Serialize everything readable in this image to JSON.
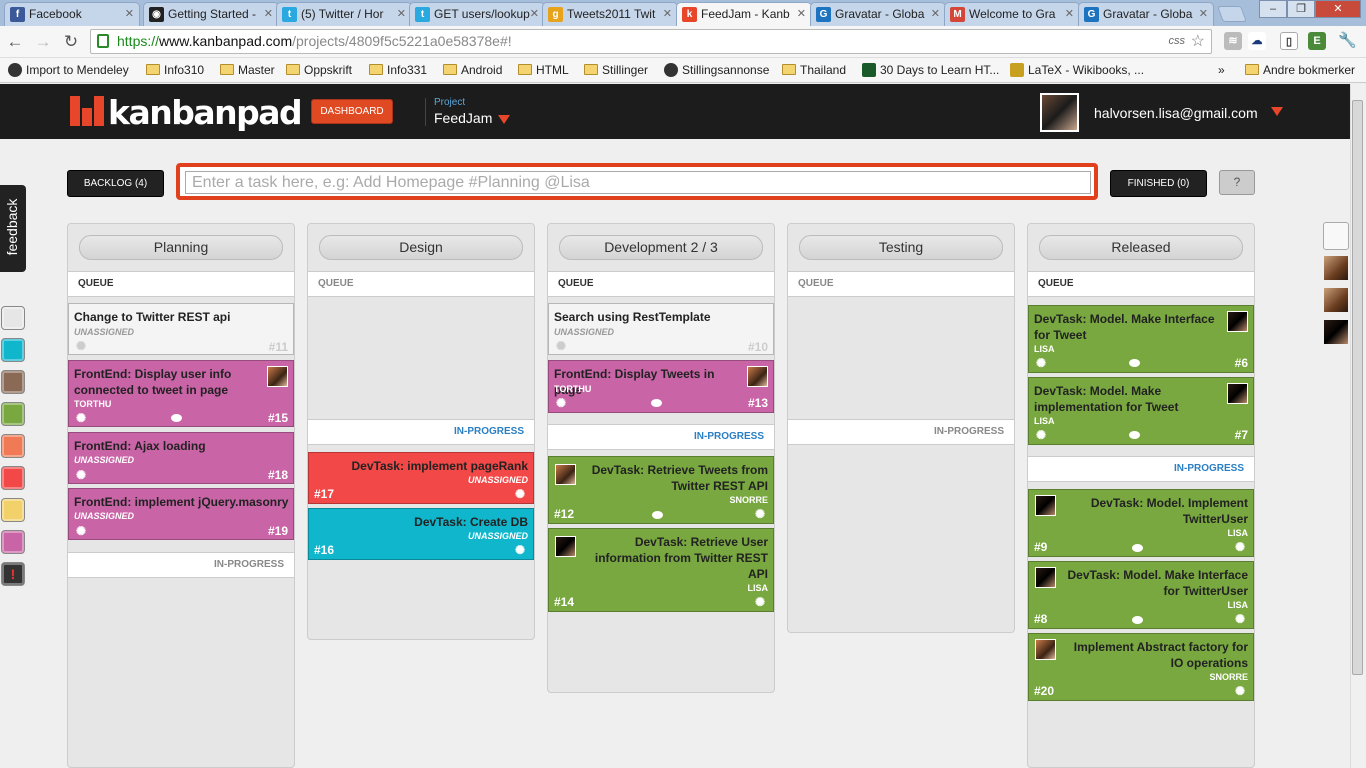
{
  "browser": {
    "tabs": [
      {
        "label": "Facebook",
        "icon": "facebook-icon",
        "color": "#3b5998",
        "glyph": "f"
      },
      {
        "label": "Getting Started -",
        "icon": "github-icon",
        "color": "#222222",
        "glyph": "◉"
      },
      {
        "label": "(5) Twitter / Hor",
        "icon": "twitter-icon",
        "color": "#2aa9e0",
        "glyph": "t"
      },
      {
        "label": "GET users/lookup",
        "icon": "twitter-icon",
        "color": "#2aa9e0",
        "glyph": "t"
      },
      {
        "label": "Tweets2011 Twit",
        "icon": "google-icon",
        "color": "#e8a31d",
        "glyph": "g"
      },
      {
        "label": "FeedJam - Kanb",
        "icon": "kanbanpad-icon",
        "color": "#e8462a",
        "glyph": "k"
      },
      {
        "label": "Gravatar - Globa",
        "icon": "gravatar-icon",
        "color": "#1e73be",
        "glyph": "G"
      },
      {
        "label": "Welcome to Gra",
        "icon": "gmail-icon",
        "color": "#d44638",
        "glyph": "M"
      },
      {
        "label": "Gravatar - Globa",
        "icon": "gravatar-icon",
        "color": "#1e73be",
        "glyph": "G"
      }
    ],
    "url_scheme": "https://",
    "url_host": "www.kanbanpad.com",
    "url_path": "/projects/4809f5c5221a0e58378e#!",
    "css_label": "css",
    "bookmarks": [
      {
        "label": "Import to Mendeley",
        "type": "mendeley"
      },
      {
        "label": "Info310",
        "type": "folder"
      },
      {
        "label": "Master",
        "type": "folder"
      },
      {
        "label": "Oppskrift",
        "type": "folder"
      },
      {
        "label": "Info331",
        "type": "folder"
      },
      {
        "label": "Android",
        "type": "folder"
      },
      {
        "label": "HTML",
        "type": "folder"
      },
      {
        "label": "Stillinger",
        "type": "folder"
      },
      {
        "label": "Stillingsannonse",
        "type": "mendeley"
      },
      {
        "label": "Thailand",
        "type": "folder"
      },
      {
        "label": "30 Days to Learn HT...",
        "type": "ext"
      },
      {
        "label": "LaTeX - Wikibooks, ...",
        "type": "ext"
      },
      {
        "label": "»",
        "type": "more"
      },
      {
        "label": "Andre bokmerker",
        "type": "folder"
      }
    ]
  },
  "app": {
    "dashboard_label": "DASHBOARD",
    "project_label": "Project",
    "project_name": "FeedJam",
    "user_email": "halvorsen.lisa@gmail.com",
    "backlog_label": "BACKLOG (4)",
    "task_placeholder": "Enter a task here, e.g: Add Homepage #Planning @Lisa",
    "finished_label": "FINISHED (0)",
    "help_label": "?",
    "feedback_label": "feedback",
    "swatches": [
      "#e6e6e6",
      "#10b6cc",
      "#8a6a55",
      "#78a83f",
      "#f07a55",
      "#f24848",
      "#f2d06a",
      "#c964a7",
      "#333333"
    ],
    "queue_label": "QUEUE",
    "inprogress_label": "IN-PROGRESS",
    "columns": [
      {
        "name": "Planning"
      },
      {
        "name": "Design"
      },
      {
        "name": "Development 2 / 3"
      },
      {
        "name": "Testing"
      },
      {
        "name": "Released"
      }
    ],
    "cards": {
      "c11": {
        "title": "Change to Twitter REST api",
        "assignee": "UNASSIGNED",
        "num": "#11"
      },
      "c15": {
        "title": "FrontEnd: Display user info connected to tweet in page",
        "assignee": "TORTHU",
        "num": "#15"
      },
      "c18": {
        "title": "FrontEnd: Ajax loading",
        "assignee": "UNASSIGNED",
        "num": "#18"
      },
      "c19": {
        "title": "FrontEnd: implement jQuery.masonry",
        "assignee": "UNASSIGNED",
        "num": "#19"
      },
      "c17": {
        "title": "DevTask: implement pageRank",
        "assignee": "UNASSIGNED",
        "num": "#17"
      },
      "c16": {
        "title": "DevTask: Create DB",
        "assignee": "UNASSIGNED",
        "num": "#16"
      },
      "c10": {
        "title": "Search using RestTemplate",
        "assignee": "UNASSIGNED",
        "num": "#10"
      },
      "c13": {
        "title": "FrontEnd: Display Tweets in page",
        "assignee": "TORTHU",
        "num": "#13"
      },
      "c12": {
        "title": "DevTask: Retrieve Tweets from Twitter REST API",
        "assignee": "SNORRE",
        "num": "#12"
      },
      "c14": {
        "title": "DevTask: Retrieve User information from Twitter REST API",
        "assignee": "LISA",
        "num": "#14"
      },
      "c6": {
        "title": "DevTask: Model. Make Interface for Tweet",
        "assignee": "LISA",
        "num": "#6"
      },
      "c7": {
        "title": "DevTask: Model. Make implementation for Tweet",
        "assignee": "LISA",
        "num": "#7"
      },
      "c9": {
        "title": "DevTask: Model. Implement TwitterUser",
        "assignee": "LISA",
        "num": "#9"
      },
      "c8": {
        "title": "DevTask: Model. Make Interface for TwitterUser",
        "assignee": "LISA",
        "num": "#8"
      },
      "c20": {
        "title": "Implement Abstract factory for IO operations",
        "assignee": "SNORRE",
        "num": "#20"
      }
    }
  }
}
